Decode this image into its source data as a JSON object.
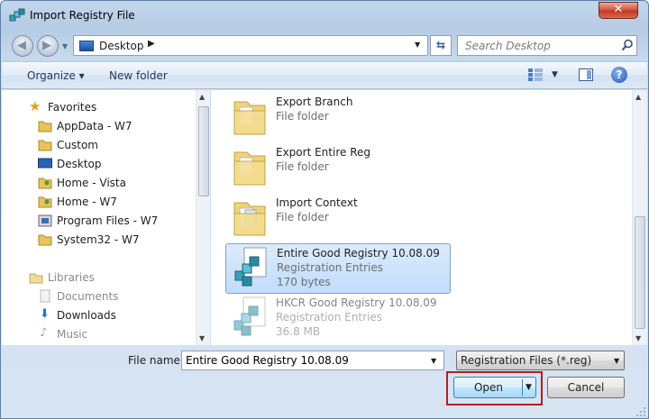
{
  "window": {
    "title": "Import Registry File",
    "close_label": "✕"
  },
  "address": {
    "location": "Desktop",
    "separator": "▶"
  },
  "search": {
    "placeholder": "Search Desktop"
  },
  "toolbar": {
    "organize": "Organize ▾",
    "new_folder": "New folder",
    "help": "?"
  },
  "nav": {
    "favorites_header": "Favorites",
    "favorites": [
      "AppData - W7",
      "Custom",
      "Desktop",
      "Home - Vista",
      "Home - W7",
      "Program Files - W7",
      "System32 - W7"
    ],
    "libraries_header": "Libraries",
    "libraries": [
      "Documents",
      "Downloads",
      "Music"
    ]
  },
  "files": [
    {
      "name": "Export Branch",
      "type": "File folder",
      "size": ""
    },
    {
      "name": "Export Entire Reg",
      "type": "File folder",
      "size": ""
    },
    {
      "name": "Import Context",
      "type": "File folder",
      "size": ""
    },
    {
      "name": "Entire Good Registry 10.08.09",
      "type": "Registration Entries",
      "size": "170 bytes"
    },
    {
      "name": "HKCR Good Registry 10.08.09",
      "type": "Registration Entries",
      "size": "36.8 MB"
    }
  ],
  "bottom": {
    "file_name_label": "File name:",
    "file_name_value": "Entire Good Registry 10.08.09",
    "filter_value": "Registration Files (*.reg)",
    "open_label": "Open",
    "cancel_label": "Cancel"
  },
  "colors": {
    "selection": "#c1dcfc",
    "highlight_box": "#b41d1d",
    "window_frame": "#b6cbe4"
  }
}
